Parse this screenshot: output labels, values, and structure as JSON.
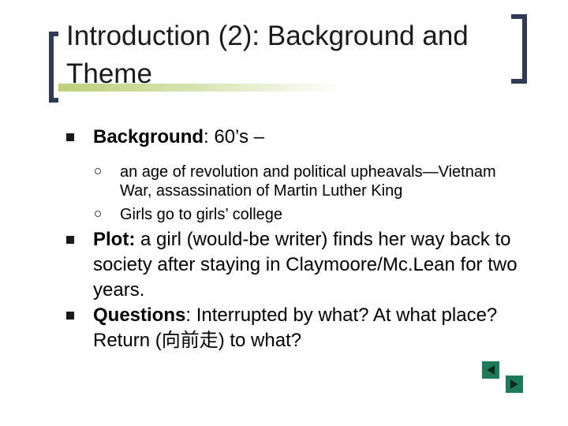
{
  "title": {
    "text": "Introduction (2): Background and Theme"
  },
  "bullets": [
    {
      "label": "Background",
      "text": ": 60’s –",
      "sub": [
        "an age of revolution and political upheavals—Vietnam War, assassination of Martin Luther King",
        "Girls go to girls’ college"
      ]
    },
    {
      "label": "Plot:",
      "text": " a girl (would-be writer) finds her way back to society after staying in Claymoore/Mc.Lean for two years."
    },
    {
      "label": "Questions",
      "text": ": Interrupted by what?  At what place?  Return (向前走) to what?"
    }
  ],
  "nav": {
    "prev_icon": "triangle-left-icon",
    "next_icon": "triangle-right-icon",
    "color": "#1f7a5a"
  },
  "colors": {
    "bracket": "#2f3b55",
    "accent_bar": "#bcd07a"
  }
}
